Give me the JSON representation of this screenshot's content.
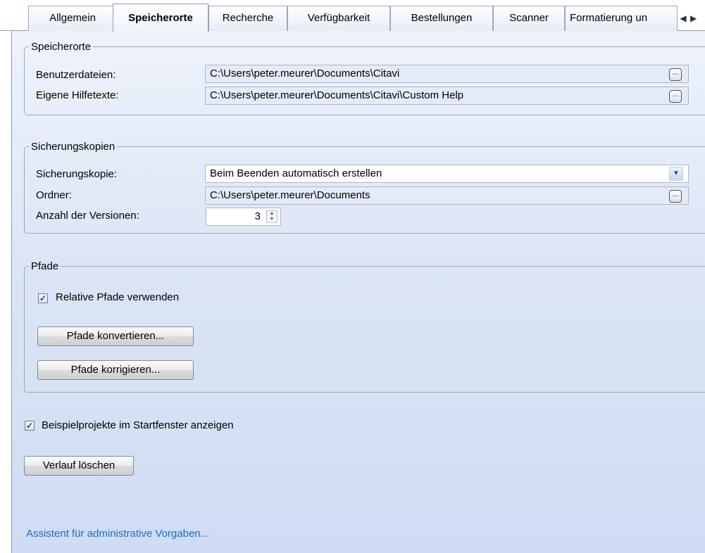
{
  "tabs": [
    {
      "label": "Allgemein"
    },
    {
      "label": "Speicherorte",
      "active": true
    },
    {
      "label": "Recherche"
    },
    {
      "label": "Verfügbarkeit"
    },
    {
      "label": "Bestellungen"
    },
    {
      "label": "Scanner"
    },
    {
      "label": "Formatierung un"
    }
  ],
  "tab_scroll": {
    "left": "◀",
    "right": "▶"
  },
  "speicherorte": {
    "legend": "Speicherorte",
    "benutzerdateien_label": "Benutzerdateien:",
    "benutzerdateien_value": "C:\\Users\\peter.meurer\\Documents\\Citavi",
    "hilfetexte_label": "Eigene Hilfetexte:",
    "hilfetexte_value": "C:\\Users\\peter.meurer\\Documents\\Citavi\\Custom Help",
    "browse_glyph": "..."
  },
  "sicherungskopien": {
    "legend": "Sicherungskopien",
    "kopie_label": "Sicherungskopie:",
    "kopie_value": "Beim Beenden automatisch erstellen",
    "ordner_label": "Ordner:",
    "ordner_value": "C:\\Users\\peter.meurer\\Documents",
    "versionen_label": "Anzahl der Versionen:",
    "versionen_value": "3"
  },
  "pfade": {
    "legend": "Pfade",
    "relative_label": "Relative Pfade verwenden",
    "relative_checked": true,
    "konvertieren_button": "Pfade konvertieren...",
    "korrigieren_button": "Pfade korrigieren..."
  },
  "beispiel": {
    "label": "Beispielprojekte im Startfenster anzeigen",
    "checked": true
  },
  "verlauf_button": "Verlauf löschen",
  "assistent_link": "Assistent für administrative Vorgaben...",
  "check_glyph": "✓"
}
